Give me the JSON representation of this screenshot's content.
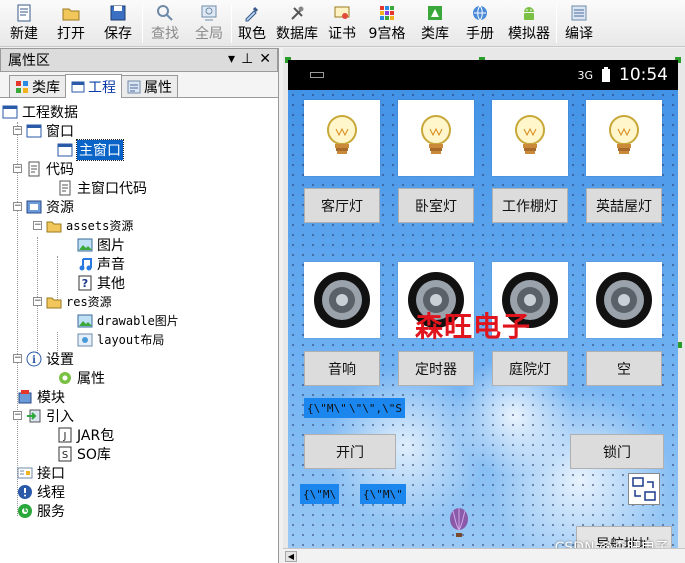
{
  "toolbar": {
    "new": "新建",
    "open": "打开",
    "save": "保存",
    "find": "查找",
    "global": "全局",
    "pick_color": "取色",
    "database": "数据库",
    "cert": "证书",
    "grid9": "9宫格",
    "class_lib": "类库",
    "manual": "手册",
    "emulator": "模拟器",
    "compile": "编译"
  },
  "panel": {
    "title": "属性区",
    "controls": {
      "dropdown": "▾",
      "pin": "⊥",
      "close": "✕"
    },
    "tabs": [
      "类库",
      "工程",
      "属性"
    ]
  },
  "tree": {
    "root": "工程数据",
    "window": "窗口",
    "main_window": "主窗口",
    "code": "代码",
    "main_window_code": "主窗口代码",
    "resources": "资源",
    "assets": "assets资源",
    "images": "图片",
    "sounds": "声音",
    "other": "其他",
    "res": "res资源",
    "drawable": "drawable图片",
    "layout": "layout布局",
    "settings": "设置",
    "properties": "属性",
    "module": "模块",
    "import": "引入",
    "jar": "JAR包",
    "so": "SO库",
    "interface": "接口",
    "thread": "线程",
    "service": "服务"
  },
  "phone": {
    "time": "10:54",
    "signal": "3G",
    "light_buttons": [
      "客厅灯",
      "卧室灯",
      "工作棚灯",
      "英喆屋灯"
    ],
    "device_buttons": [
      "音响",
      "定时器",
      "庭院灯",
      "空"
    ],
    "open_door": "开门",
    "lock_door": "锁门",
    "chip1": "{\\\"M\\\"",
    "chip2": "\\\"\\\",\\\"S",
    "chip3": "{\\\"M\\",
    "chip4": "{\\\"M\\\"",
    "bottom_btn": "导航地址",
    "watermark": "森旺电子"
  },
  "footer": {
    "csdn": "CSDN @森旺电子"
  },
  "colors": {
    "selection": "#0a64c8",
    "chip": "#1a86ee",
    "watermark": "#e0141c",
    "sky": "#4f9ce9"
  }
}
